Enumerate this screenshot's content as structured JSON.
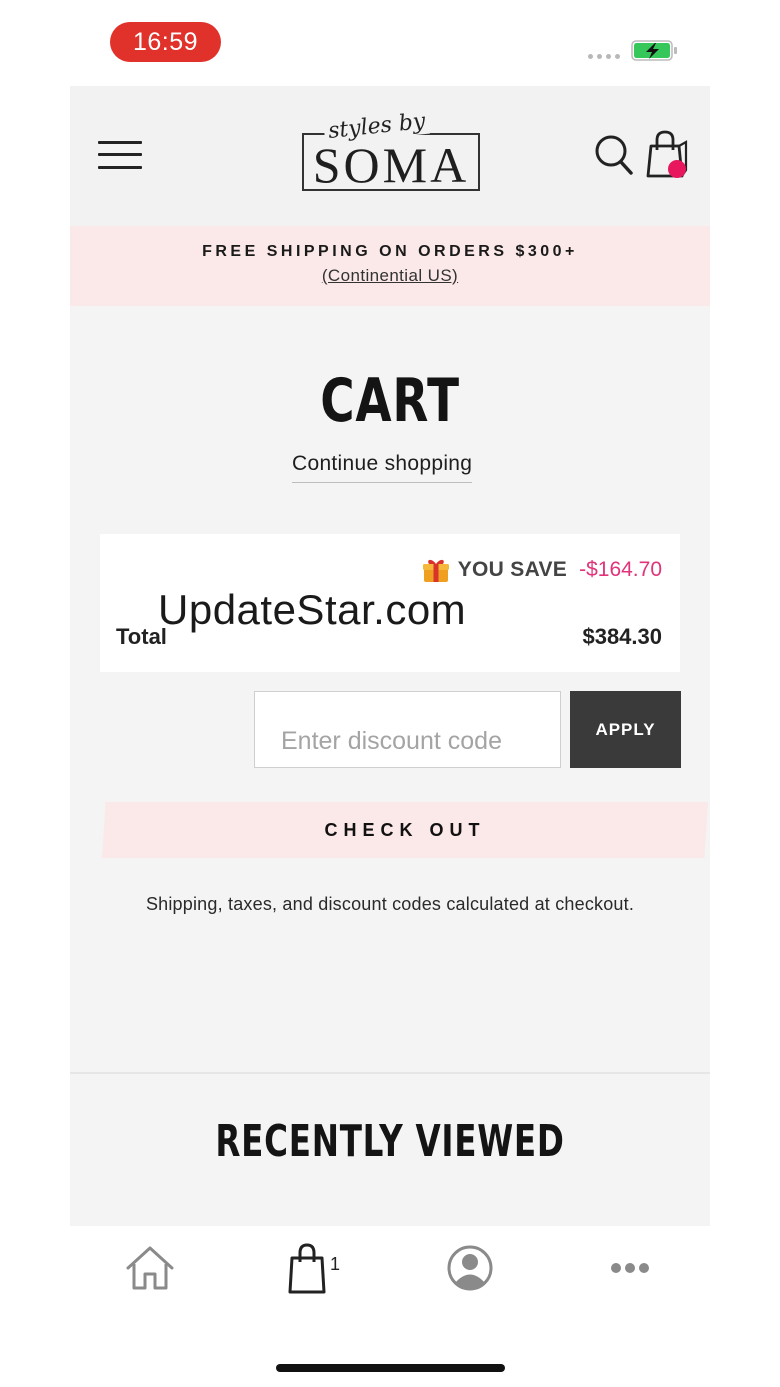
{
  "status_bar": {
    "time": "16:59"
  },
  "header": {
    "logo_script": "styles by",
    "logo_word": "SOMA"
  },
  "promo": {
    "title": "FREE SHIPPING ON ORDERS $300+",
    "subtitle": "(Continential US)"
  },
  "cart": {
    "title": "CART",
    "continue_link": "Continue shopping",
    "savings_label": "YOU SAVE",
    "savings_amount": "-$164.70",
    "total_label": "Total",
    "total_value": "$384.30",
    "discount_placeholder": "Enter discount code",
    "apply_label": "APPLY",
    "checkout_label": "CHECK OUT",
    "note": "Shipping, taxes, and discount codes calculated at checkout."
  },
  "watermark": "UpdateStar.com",
  "recently_viewed": {
    "title": "RECENTLY VIEWED"
  },
  "tabbar": {
    "bag_count": "1",
    "items": [
      "home-icon",
      "bag-icon",
      "account-icon",
      "more-icon"
    ]
  },
  "colors": {
    "accent_pink": "#e8175d",
    "promo_bg": "#fbe8e8",
    "savings_text": "#e0337a",
    "apply_bg": "#3a3a3a",
    "time_pill": "#e0312b"
  }
}
